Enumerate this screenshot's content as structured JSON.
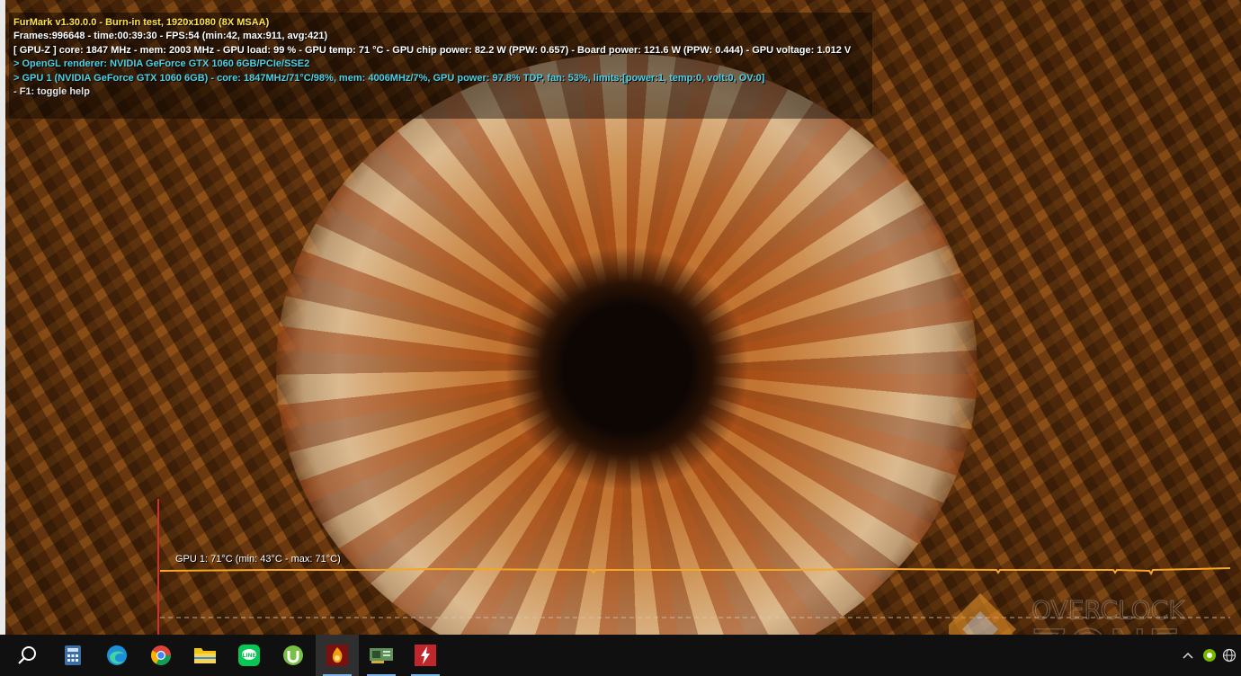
{
  "osd": {
    "title": "FurMark v1.30.0.0 - Burn-in test, 1920x1080 (8X MSAA)",
    "frames": "Frames:996648 - time:00:39:30 - FPS:54 (min:42, max:911, avg:421)",
    "gpuz": "[ GPU-Z ] core: 1847 MHz - mem: 2003 MHz - GPU load: 99 % - GPU temp: 71 °C - GPU chip power: 82.2 W (PPW: 0.657) - Board power: 121.6 W (PPW: 0.444) - GPU voltage: 1.012 V",
    "renderer": "> OpenGL renderer: NVIDIA GeForce GTX 1060 6GB/PCIe/SSE2",
    "gpu1": "> GPU 1 (NVIDIA GeForce GTX 1060 6GB) - core: 1847MHz/71°C/98%, mem: 4006MHz/7%, GPU power: 97.8% TDP, fan: 53%, limits:[power:1, temp:0, volt:0, OV:0]",
    "help": "- F1: toggle help"
  },
  "temp_graph": {
    "label": "GPU 1: 71°C (min: 43°C - max: 71°C)",
    "current": 71,
    "min": 43,
    "max": 71,
    "line_color": "#f5a623"
  },
  "watermark": {
    "text_top": "OVERCLOCK",
    "text_bottom": "ZONE"
  },
  "taskbar": {
    "items": [
      {
        "name": "search",
        "icon": "search-icon"
      },
      {
        "name": "calculator",
        "icon": "calculator-icon"
      },
      {
        "name": "edge",
        "icon": "edge-browser-icon"
      },
      {
        "name": "chrome",
        "icon": "chrome-browser-icon"
      },
      {
        "name": "file-explorer",
        "icon": "folder-icon"
      },
      {
        "name": "line",
        "icon": "line-chat-icon"
      },
      {
        "name": "utorrent",
        "icon": "utorrent-icon"
      },
      {
        "name": "furmark",
        "icon": "furmark-icon"
      },
      {
        "name": "gpu-z",
        "icon": "gpu-card-icon"
      },
      {
        "name": "flash-app",
        "icon": "lightning-icon"
      }
    ],
    "tray": [
      {
        "name": "show-hidden",
        "icon": "chevron-up-icon"
      },
      {
        "name": "nvidia",
        "icon": "nvidia-tray-icon"
      },
      {
        "name": "network",
        "icon": "globe-icon"
      }
    ]
  }
}
